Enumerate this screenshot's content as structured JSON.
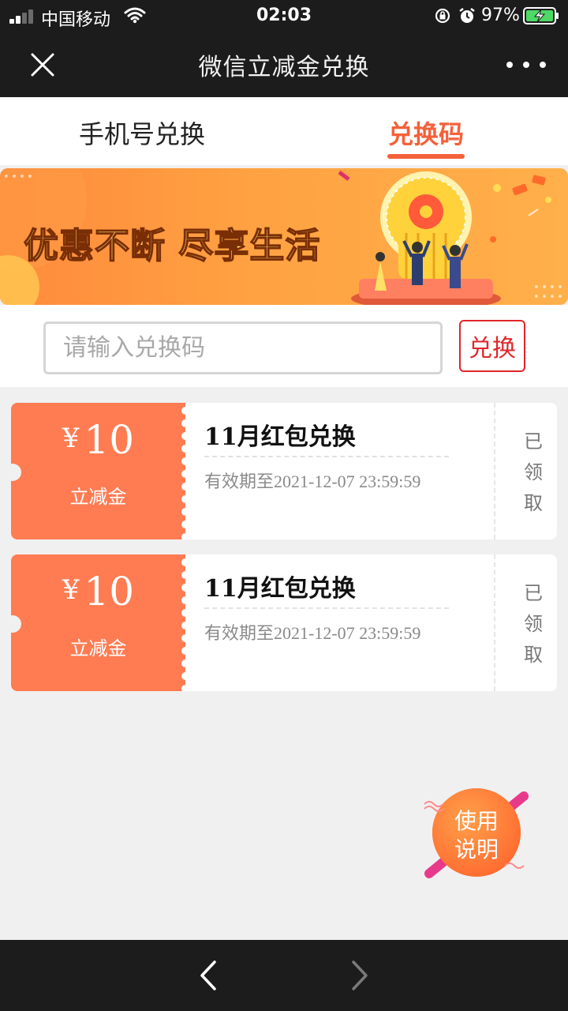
{
  "status_bar": {
    "carrier": "中国移动",
    "time": "02:03",
    "battery": "97%",
    "icons": [
      "signal-icon",
      "wifi-icon",
      "orientation-lock-icon",
      "alarm-icon",
      "battery-charging-icon"
    ]
  },
  "nav": {
    "title": "微信立减金兑换",
    "close_icon": "close-icon",
    "more_icon": "more-icon"
  },
  "tabs": [
    {
      "label": "手机号兑换",
      "active": false
    },
    {
      "label": "兑换码",
      "active": true
    }
  ],
  "banner": {
    "text": "优惠不断  尽享生活"
  },
  "redeem": {
    "placeholder": "请输入兑换码",
    "value": "",
    "button_label": "兑换"
  },
  "coupons": [
    {
      "currency": "¥",
      "amount": "10",
      "unit": "立减金",
      "title": "11月红包兑换",
      "expiry": "有效期至2021-12-07 23:59:59",
      "status": "已领取"
    },
    {
      "currency": "¥",
      "amount": "10",
      "unit": "立减金",
      "title": "11月红包兑换",
      "expiry": "有效期至2021-12-07 23:59:59",
      "status": "已领取"
    }
  ],
  "help": {
    "line1": "使用",
    "line2": "说明"
  },
  "colors": {
    "accent": "#f4613a",
    "coupon": "#ff7b52",
    "button_red": "#e0262b",
    "bar_dark": "#1c1c1c",
    "page_bg": "#f0f0f0"
  },
  "bottom_nav": {
    "icons": [
      "back-arrow-icon",
      "forward-arrow-icon"
    ]
  }
}
